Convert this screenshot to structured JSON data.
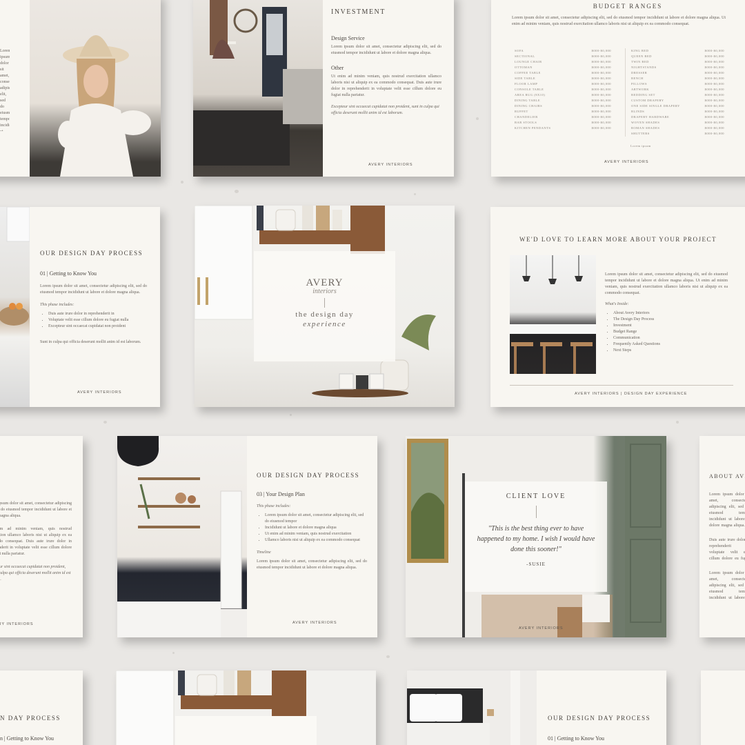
{
  "brand": "AVERY INTERIORS",
  "brand_full": "AVERY INTERIORS | DESIGN DAY EXPERIENCE",
  "logo": {
    "main": "AVERY",
    "script": "interiors",
    "tag1": "the design day",
    "tag2": "experience"
  },
  "lorem_long": "Lorem ipsum dolor sit amet, consectetur adipiscing elit, sed do eiusmod tempor incididunt ut labore et dolore magna aliqua.",
  "lorem_short": "Lorem ipsum dolor sit amet, consectetur adipiscing elit, sed do eiusmod tempor incididunt ut labore et dolore magna aliqua.",
  "investment": {
    "title": "INVESTMENT",
    "service_title": "Design Service",
    "service_text": "Lorem ipsum dolor sit amet, consectetur adipiscing elit, sed do eiusmod tempor incididunt ut labore et dolore magna aliqua.",
    "other_title": "Other",
    "other_text": "Ut enim ad minim veniam, quis nostrud exercitation ullamco laboris nisi ut aliquip ex ea commodo consequat. Duis aute irure dolor in reprehenderit in voluptate velit esse cillum dolore eu fugiat nulla pariatur.",
    "note": "Excepteur sint occaecat cupidatat non proident, sunt in culpa qui officia deserunt mollit anim id est laborum."
  },
  "budget": {
    "title": "BUDGET RANGES",
    "intro": "Lorem ipsum dolor sit amet, consectetur adipiscing elit, sed do eiusmod tempor incididunt ut labore et dolore magna aliqua. Ut enim ad minim veniam, quis nostrud exercitation ullamco laboris nisi ut aliquip ex ea commodo consequat.",
    "left": [
      "SOFA",
      "SECTIONAL",
      "LOUNGE CHAIR",
      "OTTOMAN",
      "COFFEE TABLE",
      "SIDE TABLE",
      "FLOOR LAMP",
      "CONSOLE TABLE",
      "AREA RUG (8X10)",
      "DINING TABLE",
      "DINING CHAIRS",
      "BUFFET",
      "CHANDELIER",
      "BAR STOOLS",
      "KITCHEN PENDANTS"
    ],
    "right": [
      "KING BED",
      "QUEEN BED",
      "TWIN BED",
      "NIGHTSTANDS",
      "DRESSER",
      "BENCH",
      "PILLOWS",
      "ARTWORK",
      "BEDDING SET",
      "CUSTOM DRAPERY",
      "ONE SIDE SINGLE DRAPERY",
      "BLINDS",
      "DRAPERY HARDWARE",
      "WOVEN SHADES",
      "ROMAN SHADES",
      "SHUTTERS"
    ],
    "price": "$000-$0,000",
    "note": "Lorem ipsum"
  },
  "process1": {
    "title": "OUR DESIGN DAY PROCESS",
    "step": "01 | Getting to Know You",
    "text": "Lorem ipsum dolor sit amet, consectetur adipiscing elit, sed do eiusmod tempor incididunt ut labore et dolore magna aliqua.",
    "includes": "This phase includes:",
    "bullets": [
      "Duis aute irure dolor in reprehenderit in",
      "Voluptate velit esse cillum dolore eu fugiat nulla",
      "Excepteur sint occaecat cupidatat non proident"
    ],
    "closing": "Sunt in culpa qui officia deserunt mollit anim id est laborum."
  },
  "learn": {
    "title": "WE'D LOVE TO LEARN MORE ABOUT YOUR PROJECT",
    "text": "Lorem ipsum dolor sit amet, consectetur adipiscing elit, sed do eiusmod tempor incididunt ut labore et dolore magna aliqua. Ut enim ad minim veniam, quis nostrud exercitation ullamco laboris nisi ut aliquip ex ea commodo consequat.",
    "inside": "What's Inside:",
    "items": [
      "About Avery Interiors",
      "The Design Day Process",
      "Investment",
      "Budget Range",
      "Communication",
      "Frequently Asked Questions",
      "Next Steps"
    ]
  },
  "left_frag": {
    "title": "",
    "text1": "Lorem ipsum dolor sit amet, consectetur adipiscing elit, sed do eiusmod tempor incididunt ut labore et dolore magna aliqua.",
    "text2": "Ut enim ad minim veniam, quis nostrud exercitation ullamco laboris nisi ut aliquip ex ea commodo consequat. Duis aute irure dolor in reprehenderit in voluptate velit esse cillum dolore eu fugiat nulla pariatur.",
    "note": "Excepteur sint occaecat cupidatat non proident, sunt in culpa qui officia deserunt mollit anim id est laborum."
  },
  "process3": {
    "title": "OUR DESIGN DAY PROCESS",
    "step": "03 | Your Design Plan",
    "includes": "This phase includes:",
    "bullets": [
      "Lorem ipsum dolor sit amet, consectetur adipiscing elit, sed do eiusmod tempor",
      "Incididunt ut labore et dolore magna aliqua",
      "Ut enim ad minim veniam, quis nostrud exercitation",
      "Ullamco laboris nisi ut aliquip ex ea commodo consequat"
    ],
    "timeline_label": "Timeline",
    "timeline": "Lorem ipsum dolor sit amet, consectetur adipiscing elit, sed do eiusmod tempor incididunt ut labore et dolore magna aliqua."
  },
  "client": {
    "title": "CLIENT LOVE",
    "quote": "\"This is the best thing ever to have happened to my home. I wish I would have done this sooner!\"",
    "author": "-SUSIE"
  },
  "about": {
    "title": "ABOUT AVERY",
    "text1": "Lorem ipsum dolor sit amet, consectetur adipiscing elit, sed do eiusmod tempor incididunt ut labore et dolore magna aliqua. Ut enim ad minim veniam, quis nostrud exercitation ullamco laboris.",
    "text2": "Duis aute irure dolor in reprehenderit in voluptate velit esse cillum dolore eu fugiat nulla pariatur. Excepteur sint occaecat cupidatat non proident, sunt in culpa qui officia deserunt mollit anim.",
    "text3": "Lorem ipsum dolor sit amet, consectetur adipiscing elit, sed do eiusmod tempor incididunt ut labore et dolore magna aliqua. Ut enim ad minim veniam, quis nostrud exercitation ullamco laboris nisi ut aliquip ex ea commodo consequat. Duis aute irure dolor in reprehenderit in voluptate velit esse cillum dolore eu fugiat. Excepteur sint occaecat cupidatat non proident, sunt in culpa qui officia deserunt."
  },
  "bottom": {
    "title_left": "N DAY PROCESS",
    "step_left": "n | Getting to Know You",
    "title_right": "OUR DESIGN DAY PROCESS",
    "step_right": "01 | Getting to Know You"
  }
}
